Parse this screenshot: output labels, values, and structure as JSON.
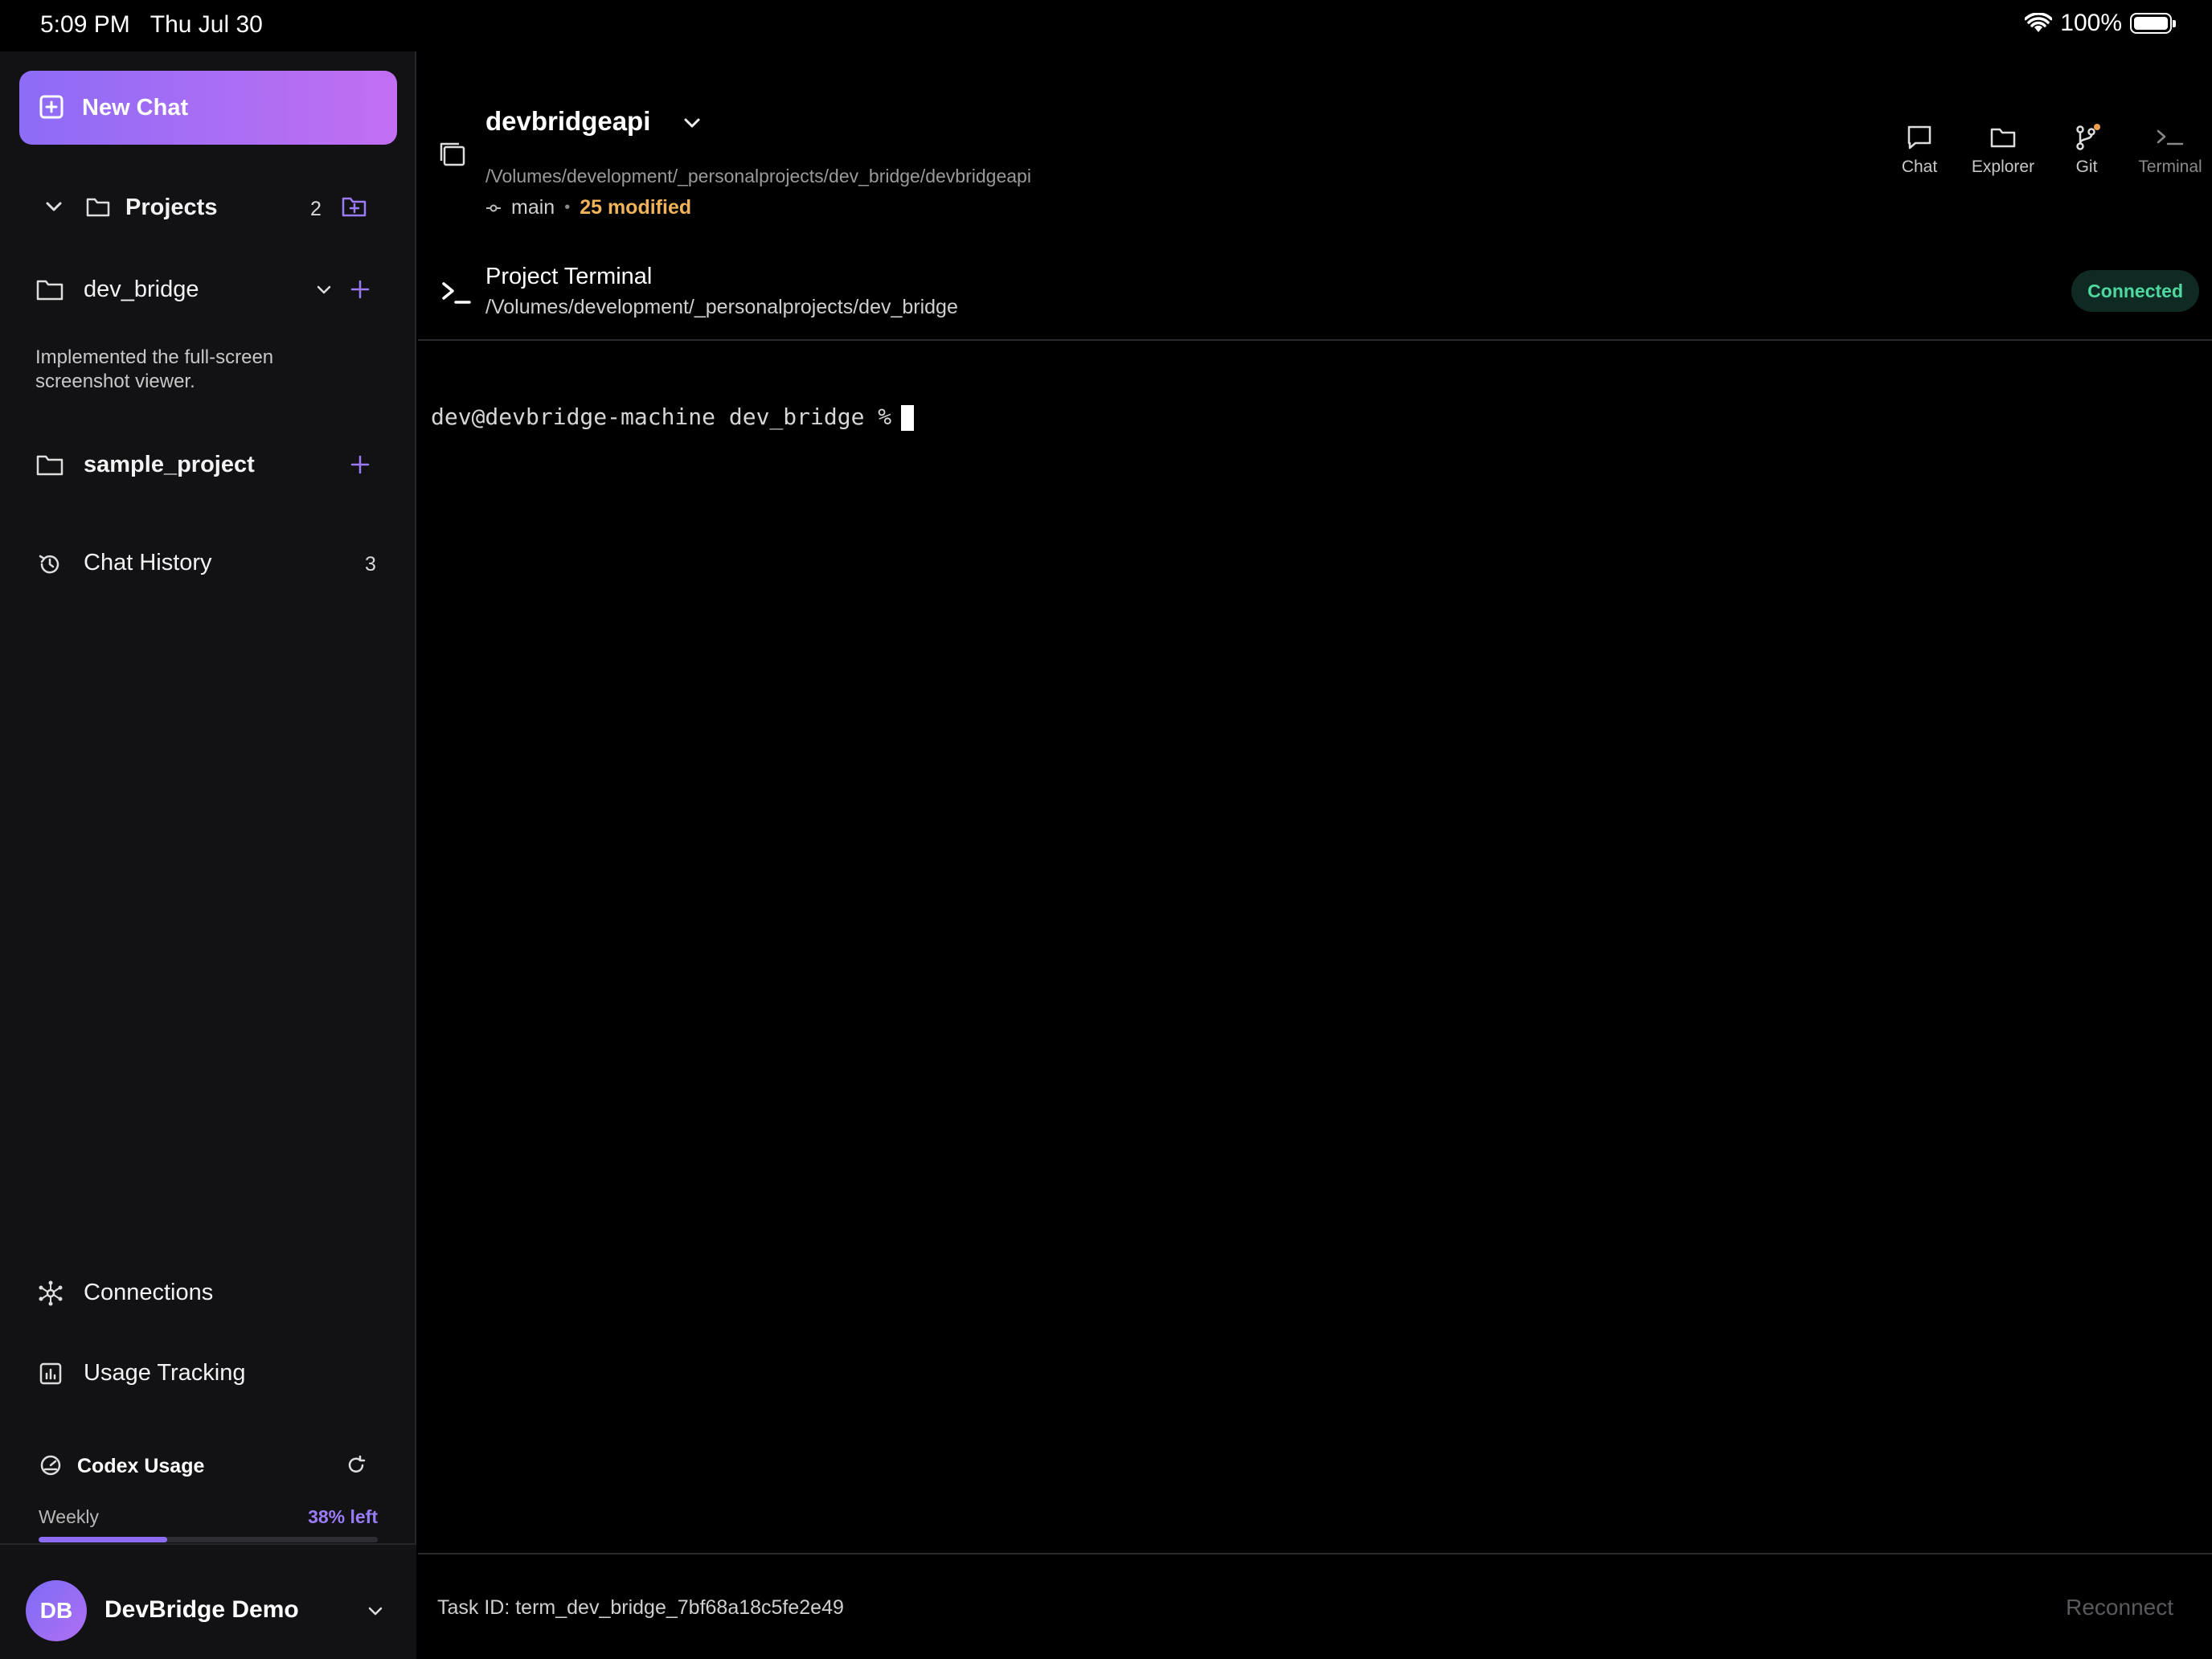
{
  "status_bar": {
    "time": "5:09 PM",
    "date": "Thu Jul 30",
    "battery": "100%"
  },
  "sidebar": {
    "new_chat_label": "New Chat",
    "projects": {
      "label": "Projects",
      "count": "2"
    },
    "items": [
      {
        "label": "dev_bridge",
        "snippet": "Implemented the full-screen screenshot viewer."
      },
      {
        "label": "sample_project"
      }
    ],
    "chat_history": {
      "label": "Chat History",
      "count": "3"
    },
    "connections_label": "Connections",
    "usage_tracking_label": "Usage Tracking",
    "codex_usage": {
      "title": "Codex Usage",
      "period": "Weekly",
      "remaining_label": "38% left",
      "remaining_fraction": 0.38
    },
    "account": {
      "initials": "DB",
      "name": "DevBridge Demo"
    }
  },
  "header": {
    "project_name": "devbridgeapi",
    "path": "/Volumes/development/_personalprojects/dev_bridge/devbridgeapi",
    "branch": "main",
    "modified": "25 modified",
    "tabs": [
      {
        "label": "Chat",
        "icon": "chat-icon"
      },
      {
        "label": "Explorer",
        "icon": "folder-icon"
      },
      {
        "label": "Git",
        "icon": "git-branch-icon"
      },
      {
        "label": "Terminal",
        "icon": "terminal-icon"
      }
    ]
  },
  "terminal": {
    "title": "Project Terminal",
    "path": "/Volumes/development/_personalprojects/dev_bridge",
    "status": "Connected",
    "prompt": "dev@devbridge-machine dev_bridge %",
    "task_id": "Task ID: term_dev_bridge_7bf68a18c5fe2e49",
    "reconnect_label": "Reconnect"
  },
  "colors": {
    "accent": "#9b7cf8",
    "modified": "#f0b35a",
    "connected": "#4fd9a0"
  }
}
